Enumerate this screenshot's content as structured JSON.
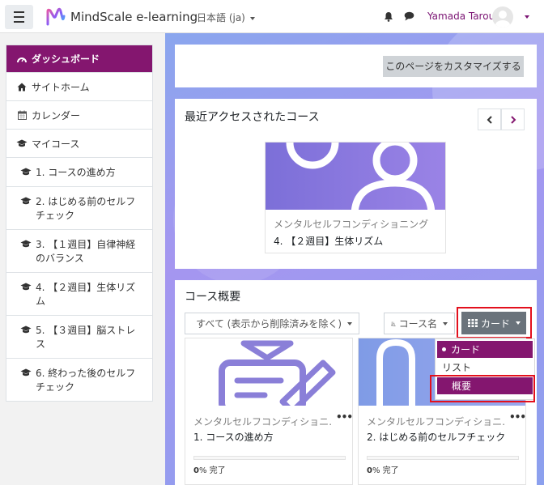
{
  "header": {
    "menu_icon": "hamburger-icon",
    "site_name": "MindScale e-learning",
    "language": "日本語 (ja)",
    "notification_icon": "bell-icon",
    "message_icon": "chat-icon",
    "username": "Yamada Tarou"
  },
  "sidebar": {
    "items": [
      {
        "label": "ダッシュボード",
        "icon": "dashboard-icon"
      },
      {
        "label": "サイトホーム",
        "icon": "home-icon"
      },
      {
        "label": "カレンダー",
        "icon": "calendar-icon"
      },
      {
        "label": "マイコース",
        "icon": "graduation-cap-icon"
      },
      {
        "label": "1. コースの進め方",
        "icon": "graduation-cap-icon"
      },
      {
        "label": "2. はじめる前のセルフチェック",
        "icon": "graduation-cap-icon"
      },
      {
        "label": "3. 【１週目】自律神経のバランス",
        "icon": "graduation-cap-icon"
      },
      {
        "label": "4. 【２週目】生体リズム",
        "icon": "graduation-cap-icon"
      },
      {
        "label": "5. 【３週目】脳ストレス",
        "icon": "graduation-cap-icon"
      },
      {
        "label": "6. 終わった後のセルフチェック",
        "icon": "graduation-cap-icon"
      }
    ]
  },
  "main": {
    "customize_label": "このページをカスタマイズする",
    "recent": {
      "title": "最近アクセスされたコース",
      "card": {
        "category": "メンタルセルフコンディショニング",
        "name": "4. 【２週目】生体リズム"
      }
    },
    "overview": {
      "title": "コース概要",
      "filter_label": "すべて (表示から削除済みを除く)",
      "sort_label": "コース名",
      "view_label": "カード",
      "view_options": [
        "カード",
        "リスト",
        "概要"
      ],
      "selected_view": "カード",
      "courses": [
        {
          "category": "メンタルセルフコンディショニ…",
          "name": "1. コースの進め方",
          "progress_pct": 0,
          "progress_suffix": "% 完了"
        },
        {
          "category": "メンタルセルフコンディショニ…",
          "name": "2. はじめる前のセルフチェック",
          "progress_pct": 0,
          "progress_suffix": "% 完了"
        }
      ]
    }
  },
  "colors": {
    "brand": "#84166f",
    "secondary_button": "#6a737b",
    "highlight_outline": "#e3101d"
  }
}
